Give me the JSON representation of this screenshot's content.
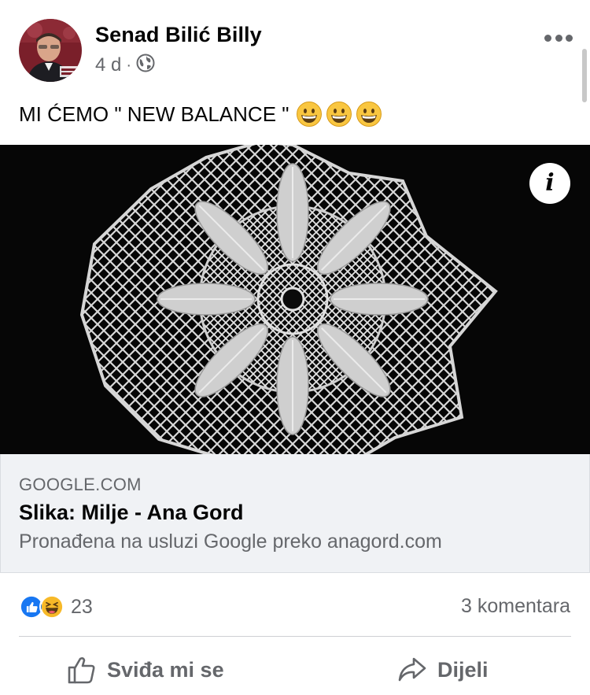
{
  "post": {
    "author": "Senad Bilić Billy",
    "time": "4 d",
    "separator": "·",
    "privacy_icon": "globe-icon",
    "text": "MI ĆEMO \" NEW BALANCE \"",
    "emojis": [
      "grinning-face",
      "grinning-face",
      "grinning-face"
    ]
  },
  "link": {
    "domain": "GOOGLE.COM",
    "title": "Slika: Milje - Ana Gord",
    "description": "Pronađena na usluzi Google preko anagord.com",
    "info_label": "i"
  },
  "engagement": {
    "reactions": [
      "like",
      "haha"
    ],
    "reaction_count": "23",
    "comments": "3 komentara"
  },
  "actions": {
    "like_label": "Sviđa mi se",
    "share_label": "Dijeli"
  },
  "colors": {
    "secondary_text": "#65676b",
    "like_blue": "#1877f2",
    "card_bg": "#f0f2f5"
  }
}
